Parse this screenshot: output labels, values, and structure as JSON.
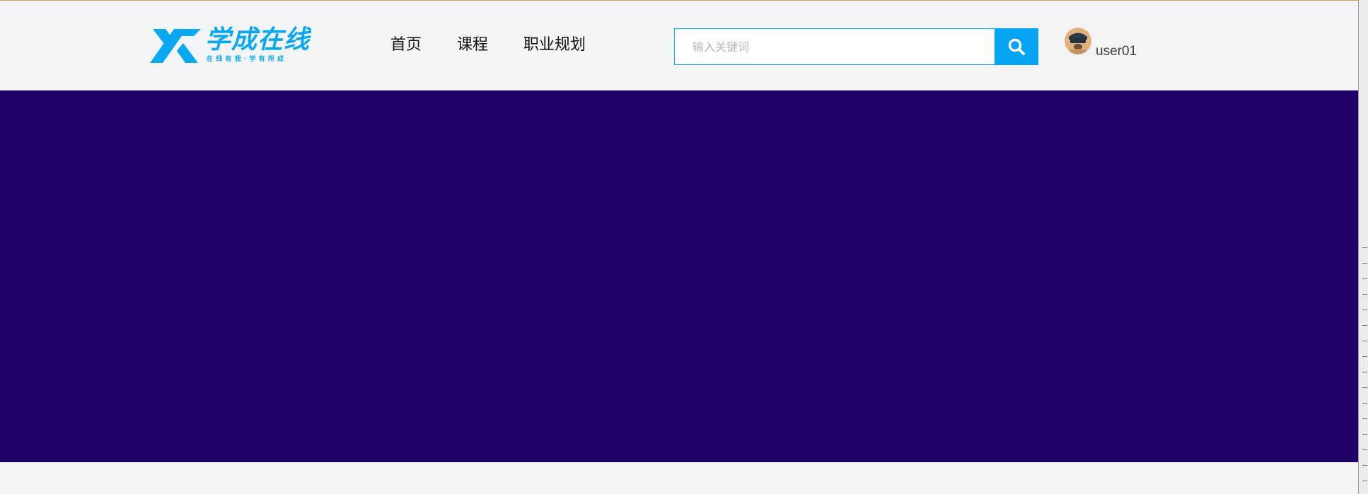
{
  "header": {
    "logo": {
      "title": "学成在线",
      "slogan": "在线有我·学有所成"
    },
    "nav": [
      {
        "label": "首页"
      },
      {
        "label": "课程"
      },
      {
        "label": "职业规划"
      }
    ],
    "search": {
      "placeholder": "输入关键词",
      "value": ""
    },
    "user": {
      "name": "user01"
    }
  },
  "colors": {
    "brand": "#0aa8f0",
    "search_button": "#07a4f4",
    "banner": "#1d0169",
    "background": "#f3f4f6"
  },
  "icons": {
    "search": "search-icon",
    "logo": "logo-mark-icon",
    "avatar": "avatar"
  }
}
